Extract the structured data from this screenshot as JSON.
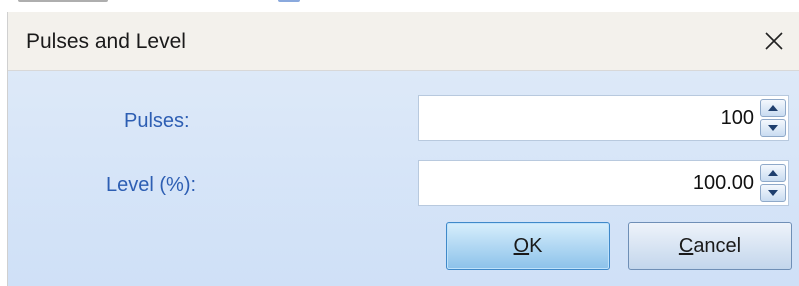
{
  "dialog": {
    "title": "Pulses and Level",
    "fields": [
      {
        "label": "Pulses:",
        "value": "100"
      },
      {
        "label": "Level (%):",
        "value": "100.00"
      }
    ],
    "buttons": {
      "ok": {
        "mnemonic": "O",
        "rest": "K"
      },
      "cancel": {
        "mnemonic": "C",
        "rest": "ancel"
      }
    }
  },
  "colors": {
    "client_bg": "#d7e6f9",
    "label_text": "#2d5eb3",
    "ok_button": "#8cc2ea"
  },
  "icons": {
    "close": "close-icon",
    "spin_up": "spin-up-icon",
    "spin_down": "spin-down-icon"
  }
}
